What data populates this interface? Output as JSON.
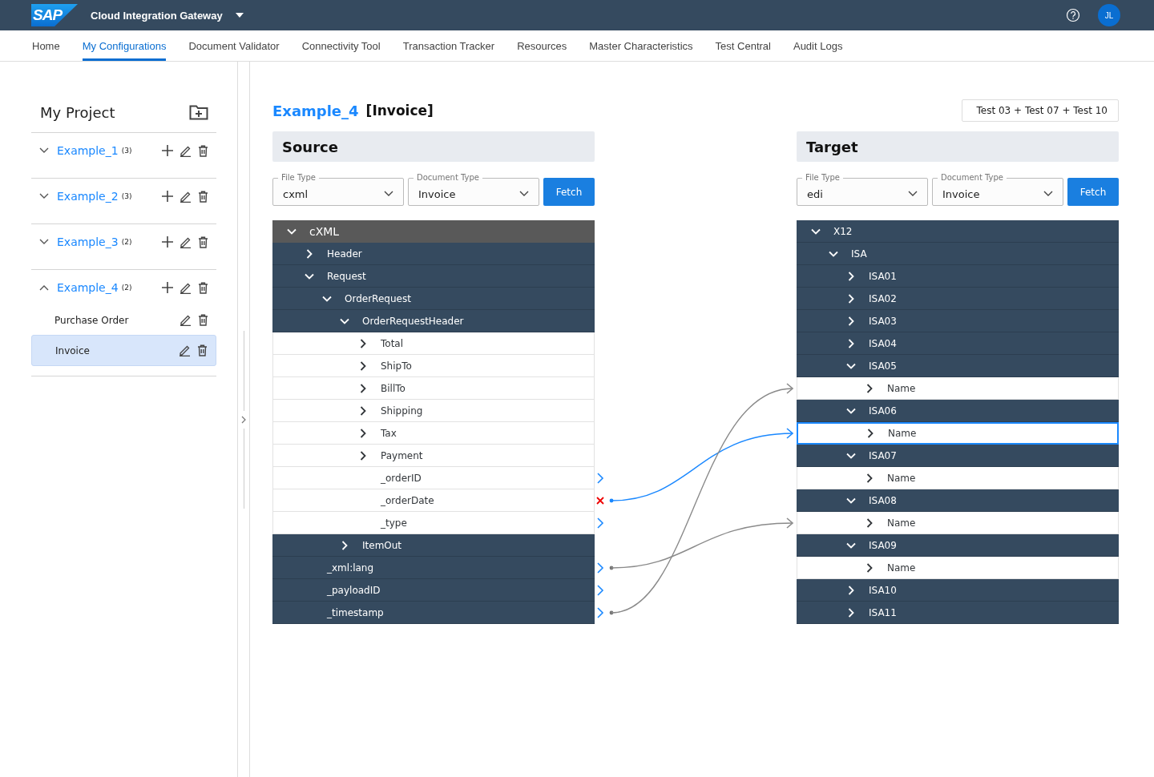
{
  "header": {
    "logo": "SAP",
    "title": "Cloud Integration Gateway",
    "avatar": "JL"
  },
  "nav": [
    {
      "label": "Home",
      "selected": false
    },
    {
      "label": "My Configurations",
      "selected": true
    },
    {
      "label": "Document Validator",
      "selected": false
    },
    {
      "label": "Connectivity Tool",
      "selected": false
    },
    {
      "label": "Transaction Tracker",
      "selected": false
    },
    {
      "label": "Resources",
      "selected": false
    },
    {
      "label": "Master Characteristics",
      "selected": false
    },
    {
      "label": "Test Central",
      "selected": false
    },
    {
      "label": "Audit Logs",
      "selected": false
    }
  ],
  "sidebar": {
    "title": "My Project",
    "projects": [
      {
        "name": "Example_1",
        "count": "(3)",
        "expanded": false
      },
      {
        "name": "Example_2",
        "count": "(3)",
        "expanded": false
      },
      {
        "name": "Example_3",
        "count": "(2)",
        "expanded": false
      },
      {
        "name": "Example_4",
        "count": "(2)",
        "expanded": true,
        "children": [
          {
            "label": "Purchase Order",
            "selected": false
          },
          {
            "label": "Invoice",
            "selected": true
          }
        ]
      }
    ]
  },
  "page": {
    "project": "Example_4",
    "document": "[Invoice]",
    "test_button": "Test 03 + Test 07 + Test 10"
  },
  "source": {
    "title": "Source",
    "fields": [
      {
        "label": "File Type",
        "value": "cxml"
      },
      {
        "label": "Document Type",
        "value": "Invoice"
      }
    ],
    "button": "Fetch",
    "tree": [
      {
        "label": "cXML",
        "kind": "header",
        "expanded": true,
        "children": [
          {
            "label": "Header",
            "kind": "branch",
            "expanded": false
          },
          {
            "label": "Request",
            "kind": "branch",
            "expanded": true,
            "children": [
              {
                "label": "OrderRequest",
                "kind": "branch",
                "expanded": true,
                "children": [
                  {
                    "label": "OrderRequestHeader",
                    "kind": "branch",
                    "expanded": true,
                    "children": [
                      {
                        "label": "Total",
                        "kind": "leaf",
                        "expanded": false
                      },
                      {
                        "label": "ShipTo",
                        "kind": "leaf",
                        "expanded": false
                      },
                      {
                        "label": "BillTo",
                        "kind": "leaf",
                        "expanded": false
                      },
                      {
                        "label": "Shipping",
                        "kind": "leaf",
                        "expanded": false
                      },
                      {
                        "label": "Tax",
                        "kind": "leaf",
                        "expanded": false
                      },
                      {
                        "label": "Payment",
                        "kind": "leaf",
                        "expanded": false
                      },
                      {
                        "label": "_orderID",
                        "kind": "leaf",
                        "mapped": true
                      },
                      {
                        "label": "_orderDate",
                        "kind": "leaf",
                        "error": true,
                        "connected": true
                      },
                      {
                        "label": "_type",
                        "kind": "leaf",
                        "mapped": true
                      }
                    ]
                  },
                  {
                    "label": "ItemOut",
                    "kind": "branch",
                    "expanded": false
                  }
                ]
              }
            ]
          },
          {
            "label": "_xml:lang",
            "kind": "branch",
            "mapped": true,
            "connected": true
          },
          {
            "label": "_payloadID",
            "kind": "branch",
            "mapped": true
          },
          {
            "label": "_timestamp",
            "kind": "branch",
            "mapped": true,
            "connected": true
          }
        ]
      }
    ]
  },
  "target": {
    "title": "Target",
    "fields": [
      {
        "label": "File Type",
        "value": "edi"
      },
      {
        "label": "Document Type",
        "value": "Invoice"
      }
    ],
    "button": "Fetch",
    "tree": [
      {
        "label": "X12",
        "kind": "branch",
        "expanded": true,
        "selected": false,
        "children": [
          {
            "label": "ISA",
            "kind": "branch",
            "expanded": true,
            "selected": false,
            "children": [
              {
                "label": "ISA01",
                "kind": "branch",
                "expanded": false,
                "selected": false
              },
              {
                "label": "ISA02",
                "kind": "branch",
                "expanded": false,
                "selected": false
              },
              {
                "label": "ISA03",
                "kind": "branch",
                "expanded": false,
                "selected": false
              },
              {
                "label": "ISA04",
                "kind": "branch",
                "expanded": false,
                "selected": false
              },
              {
                "label": "ISA05",
                "kind": "branch",
                "expanded": true,
                "selected": false,
                "children": [
                  {
                    "label": "Name",
                    "kind": "leaf",
                    "expanded": false,
                    "selected": false,
                    "connected": true
                  }
                ]
              },
              {
                "label": "ISA06",
                "kind": "branch",
                "expanded": true,
                "selected": false,
                "children": [
                  {
                    "label": "Name",
                    "kind": "leaf",
                    "expanded": false,
                    "selected": true,
                    "connected": true
                  }
                ]
              },
              {
                "label": "ISA07",
                "kind": "branch",
                "expanded": true,
                "selected": false,
                "children": [
                  {
                    "label": "Name",
                    "kind": "leaf",
                    "expanded": false,
                    "selected": false
                  }
                ]
              },
              {
                "label": "ISA08",
                "kind": "branch",
                "expanded": true,
                "selected": false,
                "children": [
                  {
                    "label": "Name",
                    "kind": "leaf",
                    "expanded": false,
                    "selected": false,
                    "connected": true
                  }
                ]
              },
              {
                "label": "ISA09",
                "kind": "branch",
                "expanded": true,
                "selected": false,
                "children": [
                  {
                    "label": "Name",
                    "kind": "leaf",
                    "expanded": false,
                    "selected": false
                  }
                ]
              },
              {
                "label": "ISA10",
                "kind": "branch",
                "expanded": false,
                "selected": false
              },
              {
                "label": "ISA11",
                "kind": "branch",
                "expanded": false,
                "selected": false
              }
            ]
          }
        ]
      }
    ]
  }
}
